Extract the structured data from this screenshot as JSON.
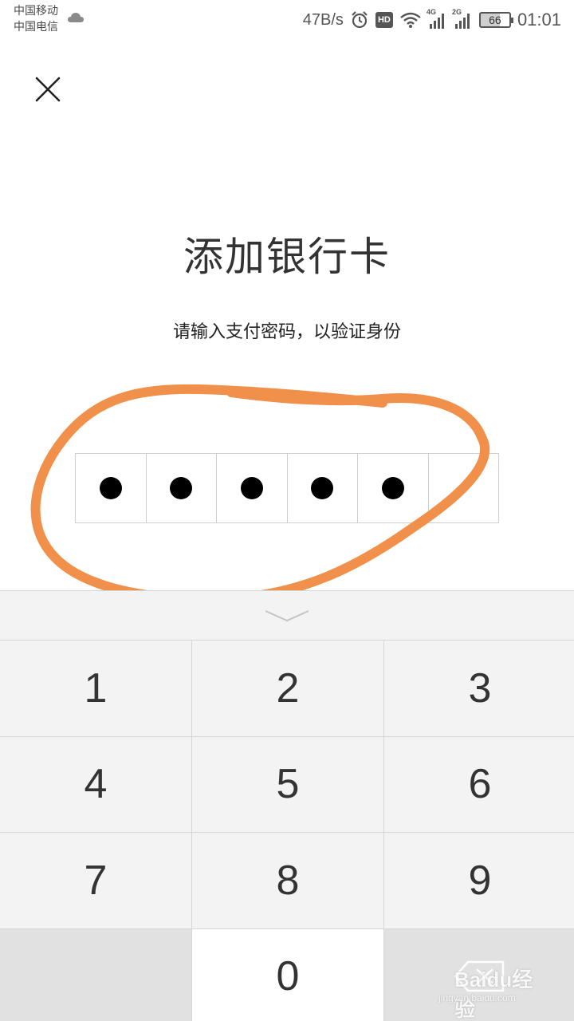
{
  "status_bar": {
    "carrier_1": "中国移动",
    "carrier_2": "中国电信",
    "net_speed": "47B/s",
    "hd_label": "HD",
    "signal_1_label": "4G",
    "signal_2_label": "2G",
    "battery_level": "66",
    "time": "01:01",
    "icons": [
      "cloud-icon",
      "alarm-icon",
      "wifi-icon",
      "signal-icon",
      "battery-icon"
    ]
  },
  "header": {
    "close_icon": "close-icon"
  },
  "main": {
    "title": "添加银行卡",
    "subtitle": "请输入支付密码，以验证身份",
    "pin_length": 6,
    "pin_filled": 5
  },
  "keypad": {
    "collapse_icon": "chevron-down-icon",
    "keys": [
      "1",
      "2",
      "3",
      "4",
      "5",
      "6",
      "7",
      "8",
      "9",
      "",
      "0",
      ""
    ],
    "delete_icon": "backspace-icon"
  },
  "watermark": {
    "brand": "Baidu经验",
    "url": "jingyan.baidu.com"
  },
  "colors": {
    "annotation": "#f0904a",
    "keypad_bg": "#f3f3f3",
    "key_text": "#333333"
  }
}
